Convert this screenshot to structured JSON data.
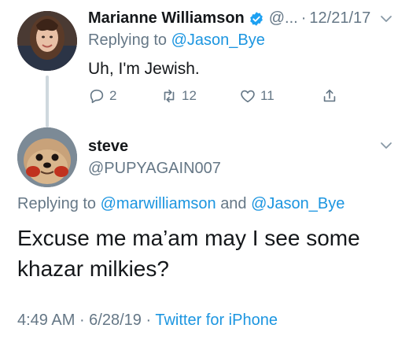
{
  "parent_tweet": {
    "author_name": "Marianne Williamson",
    "author_handle": "@...",
    "date": "12/21/17",
    "replying_prefix": "Replying to",
    "replying_to": "@Jason_Bye",
    "text": "Uh, I'm Jewish.",
    "actions": {
      "reply_count": "2",
      "retweet_count": "12",
      "like_count": "11"
    }
  },
  "reply_tweet": {
    "author_name": "steve",
    "author_handle": "@PUPYAGAIN007",
    "replying_prefix": "Replying to",
    "replying_to_1": "@marwilliamson",
    "replying_and": "and",
    "replying_to_2": "@Jason_Bye",
    "text": "Excuse me ma’am may I see some khazar milkies?",
    "time": "4:49 AM",
    "date": "6/28/19",
    "source": "Twitter for iPhone"
  },
  "colors": {
    "link": "#1b95e0",
    "secondary_text": "#657786",
    "primary_text": "#14171a",
    "thread_line": "#cfd8de",
    "verified_badge": "#1da1f2"
  },
  "icons": [
    "verified-badge-icon",
    "chevron-down-icon",
    "reply-icon",
    "retweet-icon",
    "like-icon",
    "share-icon"
  ]
}
